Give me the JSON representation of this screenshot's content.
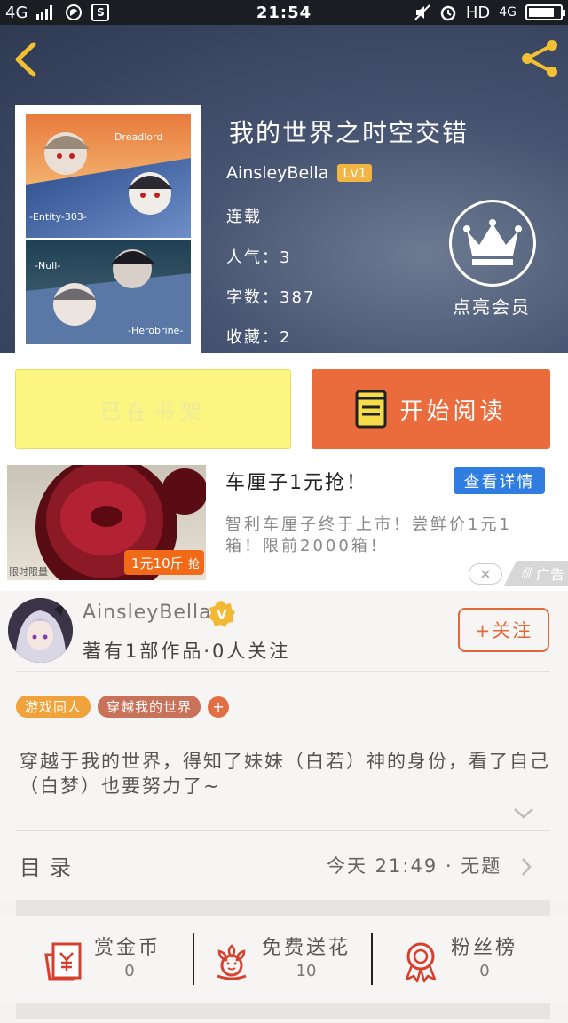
{
  "status_bar": {
    "network": "4G",
    "time": "21:54",
    "hd": "HD",
    "network_right": "4G",
    "sq_icon_letter": "S"
  },
  "book": {
    "title": "我的世界之时空交错",
    "author": "AinsleyBella",
    "level": "Lv1",
    "status": "连载",
    "popularity": "人气：3",
    "word_count": "字数：387",
    "favorites": "收藏：2",
    "vip_label": "点亮会员",
    "cover_labels": [
      "Dreadlord",
      "-Entity-303-",
      "-Null-",
      "-Herobrine-"
    ]
  },
  "buttons": {
    "on_shelf": "已在书架",
    "start_reading": "开始阅读"
  },
  "ad": {
    "title": "车厘子1元抢！",
    "cta": "查看详情",
    "description": "智利车厘子终于上市！尝鲜价1元1箱！限前2000箱！",
    "tag": "广告",
    "img_price": "1元10斤",
    "img_badge": "抢",
    "img_limit": "限时限量"
  },
  "author_section": {
    "name": "AinsleyBella",
    "v_badge": "V",
    "stats": "著有1部作品·0人关注",
    "follow": "+关注",
    "tags": [
      {
        "label": "游戏同人",
        "color": "#f0a33a"
      },
      {
        "label": "穿越我的世界",
        "color": "#c9725a"
      }
    ],
    "tag_add": "+",
    "description": "穿越于我的世界，得知了妹妹（白若）神的身份，看了自己（白梦）也要努力了~"
  },
  "toc": {
    "label": "目录",
    "latest": "今天 21:49 · 无题"
  },
  "actions": [
    {
      "label": "赏金币",
      "value": "0",
      "icon": "red-envelope-icon"
    },
    {
      "label": "免费送花",
      "value": "10",
      "icon": "flower-icon"
    },
    {
      "label": "粉丝榜",
      "value": "0",
      "icon": "award-icon"
    }
  ],
  "colors": {
    "accent": "#ea6b3c",
    "shelf": "#fcf680",
    "ad_blue": "#2f7de0"
  }
}
